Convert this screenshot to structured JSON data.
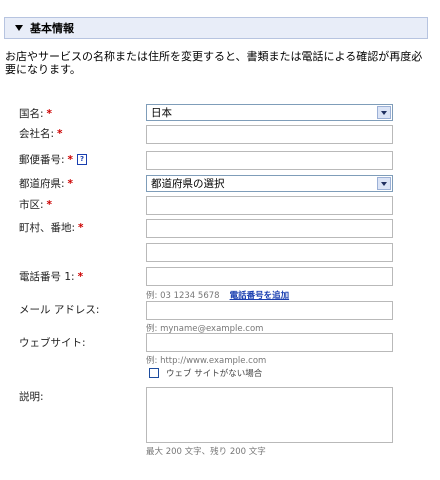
{
  "section": {
    "title": "基本情報",
    "expand_icon": "triangle-down-icon"
  },
  "notice": "お店やサービスの名称または住所を変更すると、書類または電話による確認が再度必要になります。",
  "fields": {
    "country": {
      "label": "国名:",
      "required": "*",
      "value": "日本"
    },
    "company": {
      "label": "会社名:",
      "required": "*",
      "value": ""
    },
    "postal": {
      "label": "郵便番号:",
      "required": "*",
      "help": "?",
      "value": ""
    },
    "prefecture": {
      "label": "都道府県:",
      "required": "*",
      "value": "都道府県の選択"
    },
    "city": {
      "label": "市区:",
      "required": "*",
      "value": ""
    },
    "street": {
      "label": "町村、番地:",
      "required": "*",
      "value": "",
      "value2": ""
    },
    "phone": {
      "label": "電話番号 1:",
      "required": "*",
      "value": "",
      "hint": "例: 03 1234 5678",
      "add_link": "電話番号を追加"
    },
    "email": {
      "label": "メール アドレス:",
      "value": "",
      "hint": "例: myname@example.com"
    },
    "website": {
      "label": "ウェブサイト:",
      "value": "",
      "hint": "例: http://www.example.com",
      "no_site_label": "ウェブ サイトがない場合",
      "no_site_checked": false
    },
    "description": {
      "label": "説明:",
      "value": "",
      "hint": "最大 200 文字、残り 200 文字"
    }
  }
}
